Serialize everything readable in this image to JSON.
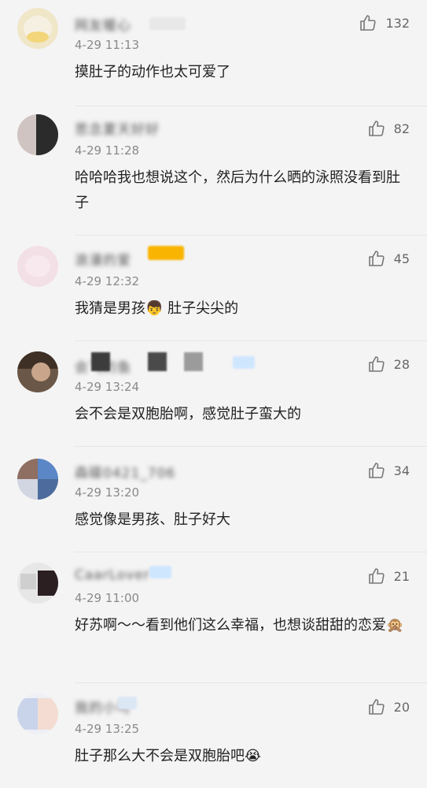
{
  "comments": [
    {
      "name": "网友暖心",
      "time": "4-29 11:13",
      "text": "摸肚子的动作也太可爱了",
      "likes": "132"
    },
    {
      "name": "思念夏天好好",
      "time": "4-29 11:28",
      "text": "哈哈哈我也想说这个，然后为什么晒的泳照没看到肚子",
      "likes": "82"
    },
    {
      "name": "浪漫的爱",
      "time": "4-29 12:32",
      "text": "我猜是男孩👦 肚子尖尖的",
      "likes": "45"
    },
    {
      "name": "会飞的鱼",
      "time": "4-29 13:24",
      "text": "会不会是双胞胎啊，感觉肚子蛮大的",
      "likes": "28"
    },
    {
      "name": "森碟0421_706",
      "time": "4-29 13:20",
      "text": "感觉像是男孩、肚子好大",
      "likes": "34"
    },
    {
      "name": "CaarLover",
      "time": "4-29 11:00",
      "text": "好苏啊～～看到他们这么幸福，也想谈甜甜的恋爱🙊",
      "likes": "21"
    },
    {
      "name": "我的小可",
      "time": "4-29 13:25",
      "text": "肚子那么大不会是双胞胎吧😭",
      "likes": "20"
    }
  ],
  "colors": {
    "background": "#f4f4f4",
    "badge": "#f8b400",
    "vip": "#cfe6ff"
  },
  "icons": {
    "like": "thumbs-up-icon"
  }
}
